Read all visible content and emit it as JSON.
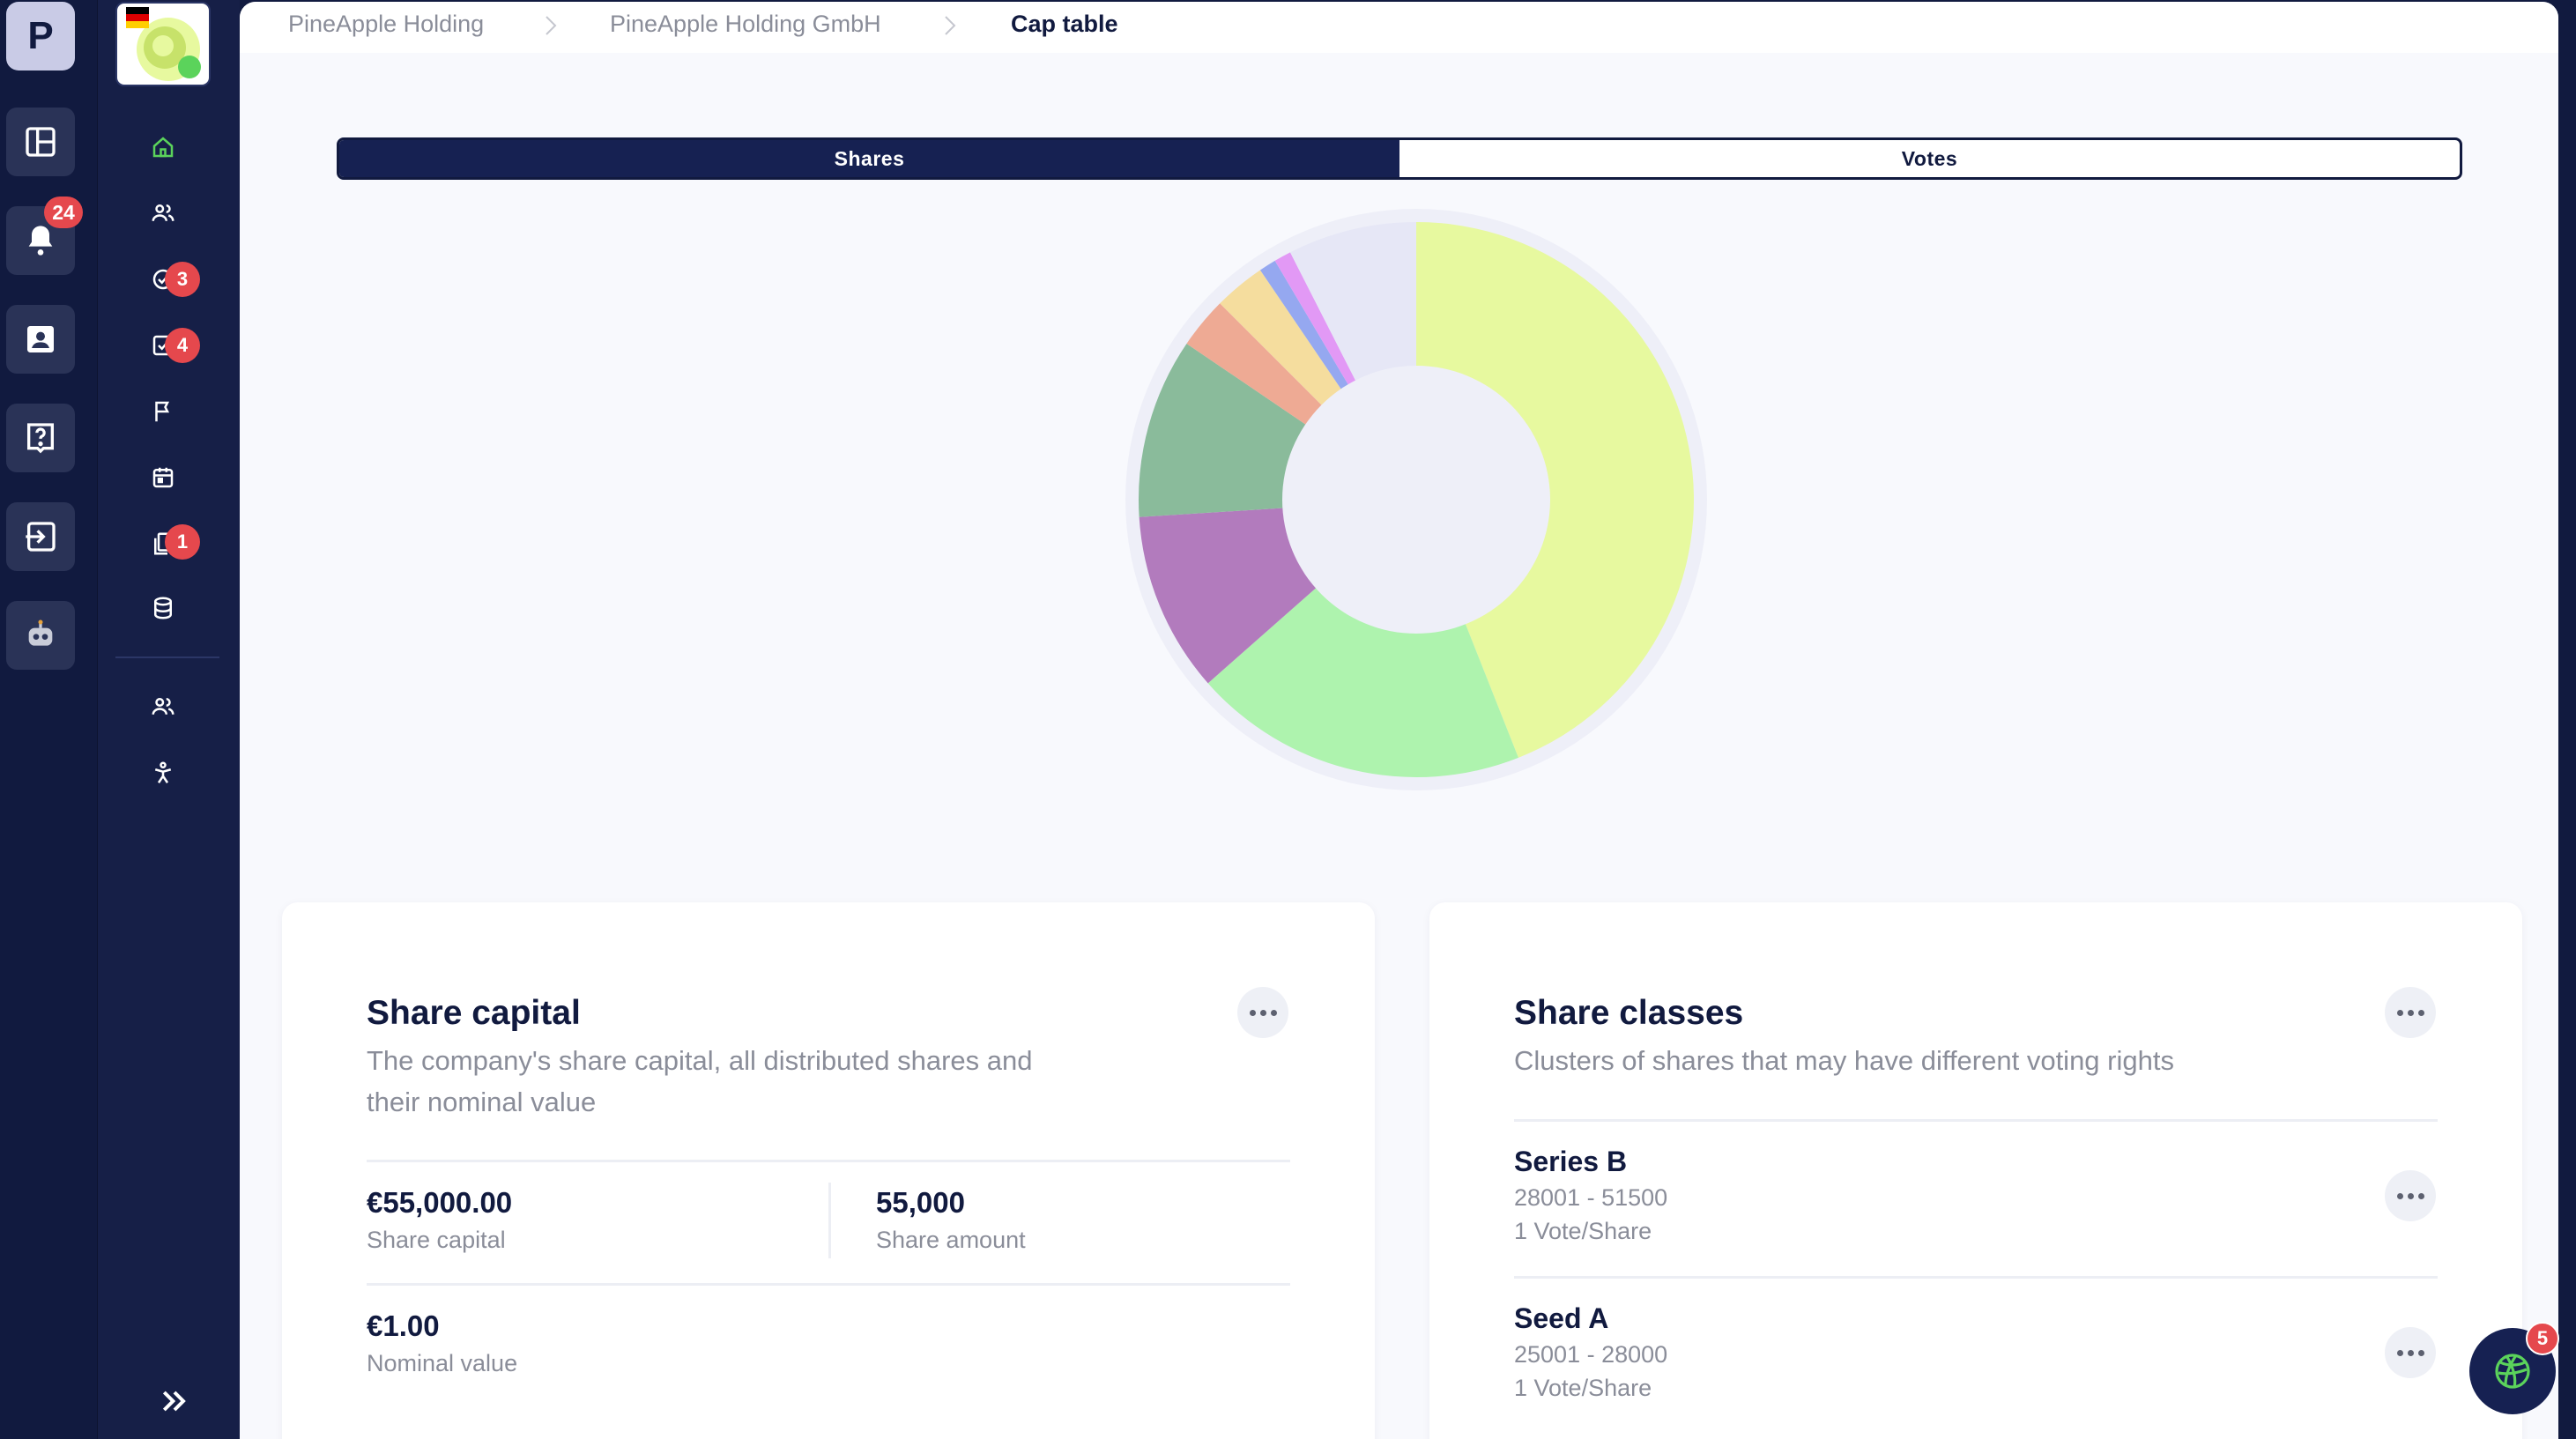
{
  "rail": {
    "logo_letter": "P",
    "notifications_badge": "24",
    "items": [
      "dashboard-icon",
      "bell-icon",
      "contact-card-icon",
      "help-icon",
      "login-icon",
      "robot-icon"
    ]
  },
  "sidebar": {
    "items": [
      {
        "icon": "home-icon",
        "badge": ""
      },
      {
        "icon": "people-icon",
        "badge": ""
      },
      {
        "icon": "check-circle-icon",
        "badge": "3"
      },
      {
        "icon": "check-square-icon",
        "badge": "4"
      },
      {
        "icon": "flag-icon",
        "badge": ""
      },
      {
        "icon": "calendar-icon",
        "badge": ""
      },
      {
        "icon": "documents-icon",
        "badge": "1"
      },
      {
        "icon": "database-icon",
        "badge": ""
      },
      {
        "icon": "people-icon",
        "badge": ""
      },
      {
        "icon": "accessibility-icon",
        "badge": ""
      }
    ]
  },
  "breadcrumb": {
    "items": [
      "PineApple Holding",
      "PineApple Holding GmbH"
    ],
    "current": "Cap table"
  },
  "toggle": {
    "shares": "Shares",
    "votes": "Votes",
    "active": "Shares"
  },
  "chart_data": {
    "type": "pie",
    "donut": true,
    "slices": [
      {
        "value": 44.0,
        "color": "#e7f99f"
      },
      {
        "value": 19.5,
        "color": "#aef3ae"
      },
      {
        "value": 10.5,
        "color": "#b27bbd"
      },
      {
        "value": 10.5,
        "color": "#8abb9b"
      },
      {
        "value": 3.0,
        "color": "#eeaa94"
      },
      {
        "value": 3.0,
        "color": "#f5dd9e"
      },
      {
        "value": 1.0,
        "color": "#95a8f0"
      },
      {
        "value": 1.0,
        "color": "#e299f5"
      },
      {
        "value": 7.5,
        "color": "#e6e7f6"
      }
    ]
  },
  "share_capital": {
    "title": "Share capital",
    "subtitle_line1": "The company's share capital, all distributed shares and",
    "subtitle_line2": "their nominal value",
    "capital_value": "€55,000.00",
    "capital_label": "Share capital",
    "amount_value": "55,000",
    "amount_label": "Share amount",
    "nominal_value": "€1.00",
    "nominal_label": "Nominal value"
  },
  "share_classes": {
    "title": "Share classes",
    "subtitle": "Clusters of shares that may have different voting rights",
    "classes": [
      {
        "name": "Series B",
        "range": "28001 - 51500",
        "votes": "1 Vote/Share"
      },
      {
        "name": "Seed A",
        "range": "25001 - 28000",
        "votes": "1 Vote/Share"
      }
    ]
  },
  "chat": {
    "badge": "5"
  }
}
